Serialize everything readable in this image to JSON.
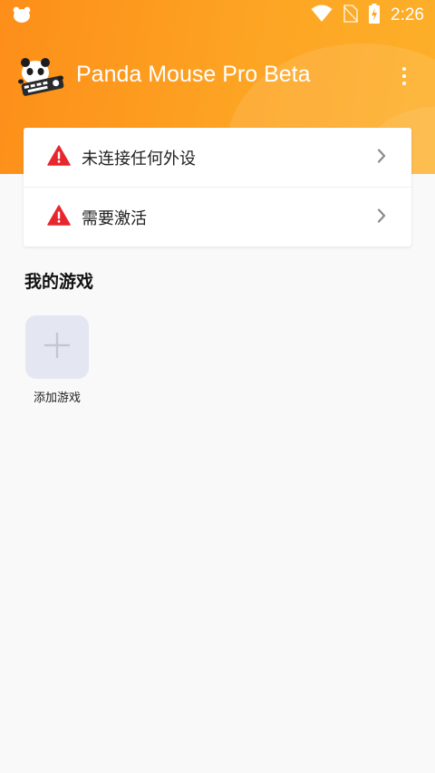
{
  "status_bar": {
    "time": "2:26",
    "icons": [
      "panda-notification-icon",
      "wifi-icon",
      "no-sim-icon",
      "battery-charging-icon"
    ]
  },
  "app": {
    "title": "Panda Mouse Pro Beta",
    "logo": "panda-logo-icon",
    "menu_icon": "more-vert-icon"
  },
  "alerts": [
    {
      "label": "未连接任何外设",
      "icon": "warning-icon",
      "action_icon": "chevron-right-icon"
    },
    {
      "label": "需要激活",
      "icon": "warning-icon",
      "action_icon": "chevron-right-icon"
    }
  ],
  "games": {
    "section_title": "我的游戏",
    "add_label": "添加游戏",
    "add_icon": "plus-icon"
  },
  "colors": {
    "header_start": "#fd8e19",
    "header_end": "#fdb02a",
    "warning": "#e8262d",
    "background": "#f9f9fa",
    "add_tile": "#e4e7f1"
  }
}
